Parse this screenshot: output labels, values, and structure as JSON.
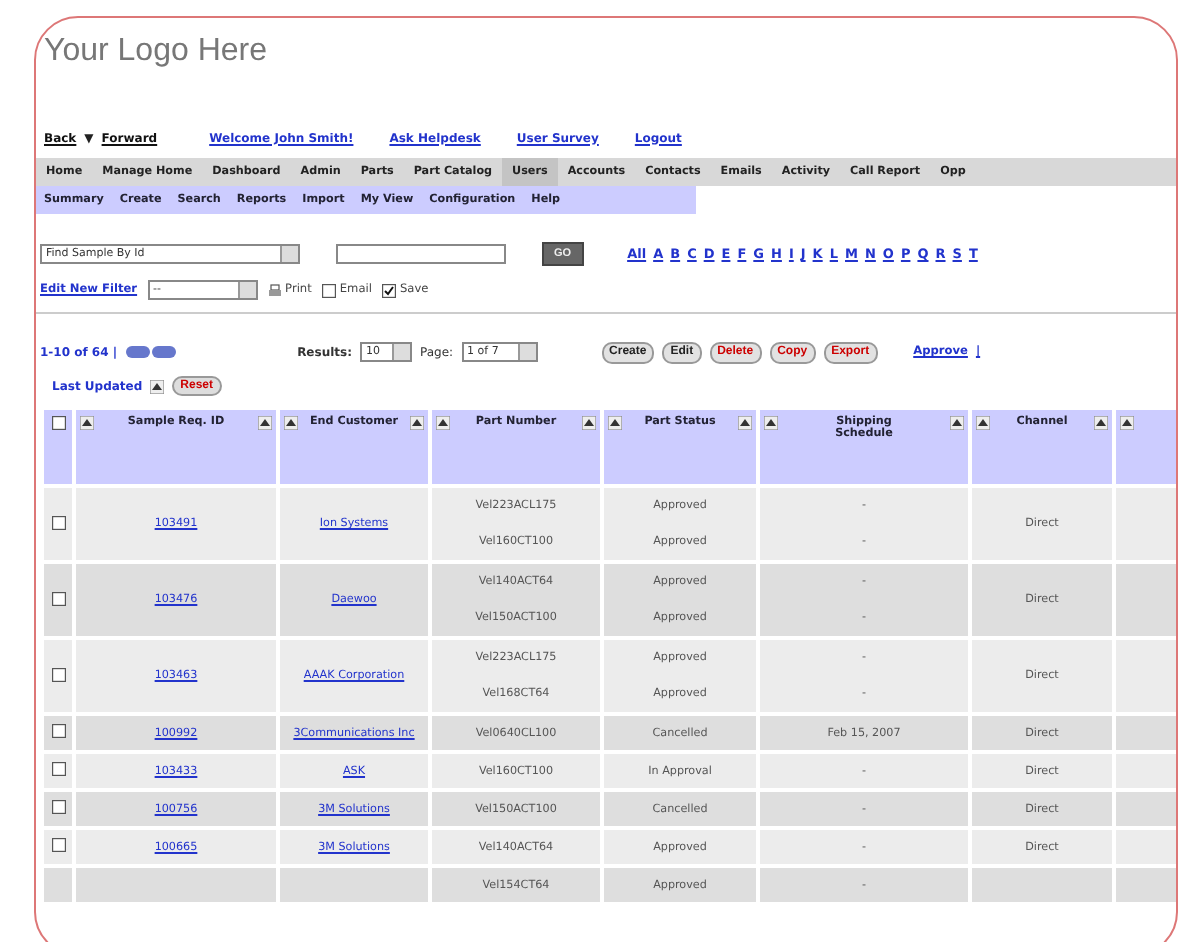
{
  "logo": "Your Logo Here",
  "top_links": [
    {
      "label": "Back",
      "kind": "link"
    },
    {
      "label": "▼",
      "kind": "caret"
    },
    {
      "label": "Forward",
      "kind": "link"
    },
    {
      "label": "Welcome John Smith!",
      "kind": "welcome"
    },
    {
      "label": "Ask Helpdesk",
      "kind": "action"
    },
    {
      "label": "User Survey",
      "kind": "action"
    },
    {
      "label": "Logout",
      "kind": "action"
    }
  ],
  "main_nav": [
    {
      "label": "Home",
      "selected": false
    },
    {
      "label": "Manage Home",
      "selected": false
    },
    {
      "label": "Dashboard",
      "selected": false
    },
    {
      "label": "Admin",
      "selected": false
    },
    {
      "label": "Parts",
      "selected": false
    },
    {
      "label": "Part Catalog",
      "selected": false
    },
    {
      "label": "Users",
      "selected": true
    },
    {
      "label": "Accounts",
      "selected": false
    },
    {
      "label": "Contacts",
      "selected": false
    },
    {
      "label": "Emails",
      "selected": false
    },
    {
      "label": "Activity",
      "selected": false
    },
    {
      "label": "Call Report",
      "selected": false
    },
    {
      "label": "Opp",
      "selected": false
    }
  ],
  "sub_nav": [
    "Summary",
    "Create",
    "Search",
    "Reports",
    "Import",
    "My View",
    "Configuration",
    "Help"
  ],
  "filter": {
    "search_by": "Find Sample By Id",
    "go": "GO",
    "letters": [
      "All",
      "A",
      "B",
      "C",
      "D",
      "E",
      "F",
      "G",
      "H",
      "I",
      "J",
      "K",
      "L",
      "M",
      "N",
      "O",
      "P",
      "Q",
      "R",
      "S",
      "T"
    ],
    "edit_filter": "Edit New Filter",
    "view_select": "--",
    "options": [
      {
        "label": "Print",
        "kind": "print"
      },
      {
        "label": "Email",
        "kind": "checkbox",
        "checked": false
      },
      {
        "label": "Save",
        "kind": "checkbox",
        "checked": true
      }
    ]
  },
  "pager": {
    "range": "1-10 of 64 |",
    "results_label": "Results:",
    "results": "10",
    "page_label": "Page:",
    "page": "1 of 7"
  },
  "actions": [
    {
      "label": "Create",
      "color": "#222222"
    },
    {
      "label": "Edit",
      "color": "#222222"
    },
    {
      "label": "Delete",
      "color": "#cc0000"
    },
    {
      "label": "Copy",
      "color": "#cc0000"
    },
    {
      "label": "Export",
      "color": "#cc0000"
    }
  ],
  "approve_links": [
    "Approve",
    "|"
  ],
  "sort": {
    "label": "Last Updated",
    "reset": "Reset"
  },
  "table": {
    "select_all_checked": false,
    "columns": [
      {
        "label": "Sample Req. ID"
      },
      {
        "label": "End Customer"
      },
      {
        "label": "Part Number"
      },
      {
        "label": "Part Status"
      },
      {
        "label": "Shipping Schedule"
      },
      {
        "label": "Channel"
      },
      {}
    ],
    "rows": [
      {
        "checked": false,
        "id": "103491",
        "customer": "Ion Systems",
        "parts": [
          "Vel223ACL175",
          "Vel160CT100"
        ],
        "status": [
          "Approved",
          "Approved"
        ],
        "schedule": [
          "-",
          "-"
        ],
        "channel": "Direct"
      },
      {
        "checked": false,
        "id": "103476",
        "customer": "Daewoo",
        "parts": [
          "Vel140ACT64",
          "Vel150ACT100"
        ],
        "status": [
          "Approved",
          "Approved"
        ],
        "schedule": [
          "-",
          "-"
        ],
        "channel": "Direct"
      },
      {
        "checked": false,
        "id": "103463",
        "customer": "AAAK Corporation",
        "parts": [
          "Vel223ACL175",
          "Vel168CT64"
        ],
        "status": [
          "Approved",
          "Approved"
        ],
        "schedule": [
          "-",
          "-"
        ],
        "channel": "Direct"
      },
      {
        "checked": false,
        "id": "100992",
        "customer": "3Communications Inc",
        "parts": [
          "Vel0640CL100"
        ],
        "status": [
          "Cancelled"
        ],
        "schedule": [
          "Feb 15, 2007"
        ],
        "channel": "Direct"
      },
      {
        "checked": false,
        "id": "103433",
        "customer": "ASK",
        "parts": [
          "Vel160CT100"
        ],
        "status": [
          "In Approval"
        ],
        "schedule": [
          "-"
        ],
        "channel": "Direct"
      },
      {
        "checked": false,
        "id": "100756",
        "customer": "3M Solutions",
        "parts": [
          "Vel150ACT100"
        ],
        "status": [
          "Cancelled"
        ],
        "schedule": [
          "-"
        ],
        "channel": "Direct"
      },
      {
        "checked": false,
        "id": "100665",
        "customer": "3M Solutions",
        "parts": [
          "Vel140ACT64"
        ],
        "status": [
          "Approved"
        ],
        "schedule": [
          "-"
        ],
        "channel": "Direct"
      },
      {
        "parts": [
          "Vel154CT64"
        ],
        "status": [
          "Approved"
        ],
        "schedule": [
          "-"
        ]
      }
    ]
  }
}
